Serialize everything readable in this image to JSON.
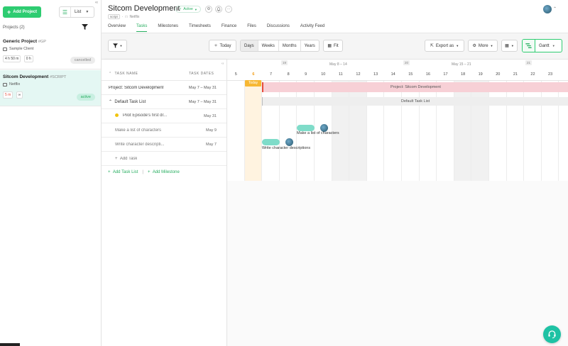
{
  "sidebar": {
    "add_project_label": "Add Project",
    "view_label": "List",
    "projects_count_label": "Projects (2)",
    "projects": [
      {
        "name": "Generic Project",
        "tag": "#GP",
        "client": "Sample Client",
        "chips": [
          "4 h 50 m",
          "0 h"
        ],
        "status": "cancelled"
      },
      {
        "name": "Sitcom Development",
        "tag": "#SCRIPT",
        "client": "Netflix",
        "chips": [
          "5 m",
          "∞"
        ],
        "status": "active"
      }
    ]
  },
  "header": {
    "title": "Sitcom Development",
    "status_badge": "Active",
    "script_tag": "script",
    "client": "Netflix",
    "tabs": [
      "Overview",
      "Tasks",
      "Milestones",
      "Timesheets",
      "Finance",
      "Files",
      "Discussions",
      "Activity Feed"
    ],
    "active_tab": "Tasks"
  },
  "toolbar": {
    "today_label": "Today",
    "scales": [
      "Days",
      "Weeks",
      "Months",
      "Years"
    ],
    "active_scale": "Days",
    "fit_label": "Fit",
    "export_label": "Export as",
    "more_label": "More",
    "view_mode_label": "Gantt"
  },
  "task_list": {
    "col_name": "TASK NAME",
    "col_dates": "TASK DATES",
    "rows": [
      {
        "name": "Project: Sitcom Development",
        "dates": "May 7 – May 31"
      },
      {
        "name": "Default Task List",
        "dates": "May 7 – May 31"
      },
      {
        "name": "Pilot Episode's first dr...",
        "dates": "May 31"
      },
      {
        "name": "Make a list of characters",
        "dates": "May 9"
      },
      {
        "name": "Write character descripti...",
        "dates": "May 7"
      }
    ],
    "add_task_label": "Add Task",
    "add_task_list_label": "Add Task List",
    "add_milestone_label": "Add Milestone",
    "separator": "|"
  },
  "gantt": {
    "week_numbers": [
      "19",
      "20",
      "21"
    ],
    "week_ranges": [
      "May 8 – 14",
      "May 15 – 21"
    ],
    "days": [
      "5",
      "6",
      "7",
      "8",
      "9",
      "10",
      "11",
      "12",
      "13",
      "14",
      "15",
      "16",
      "17",
      "18",
      "19",
      "20",
      "21",
      "22",
      "23"
    ],
    "today_day": "6",
    "today_label": "Today",
    "project_bar_label": "Project: Sitcom Development",
    "tasklist_bar_label": "Default Task List",
    "task_bars": [
      {
        "label": "Make a list of characters"
      },
      {
        "label": "Write character descriptions"
      }
    ]
  },
  "colors": {
    "accent_green": "#2ecc71",
    "today_orange": "#f7b733",
    "project_bar": "#f7d0d6",
    "task_pill": "#7fdcc9"
  }
}
